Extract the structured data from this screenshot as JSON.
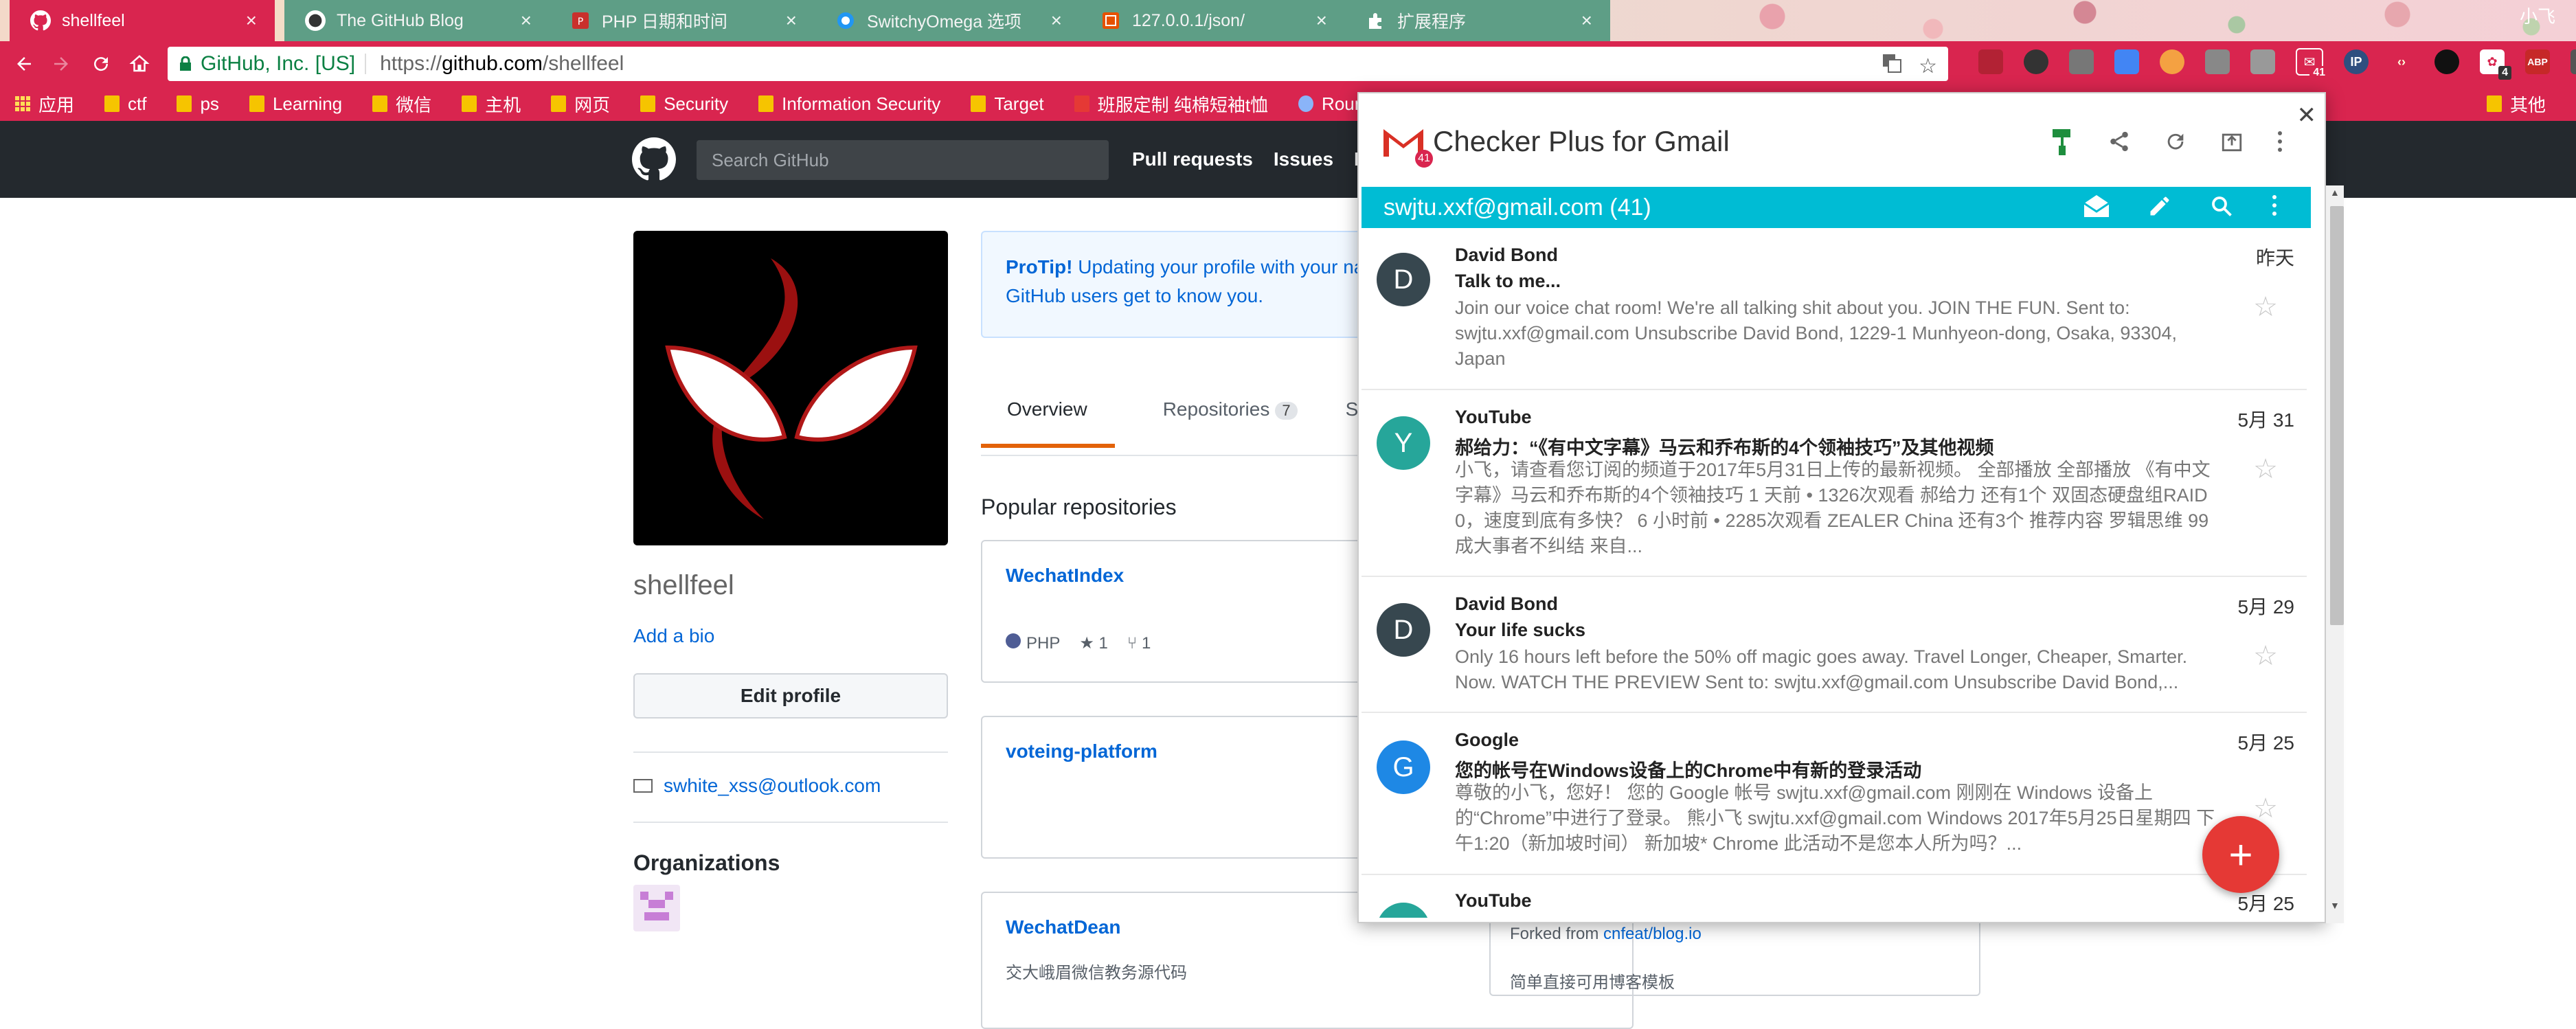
{
  "browser": {
    "tabs": [
      {
        "title": "shellfeel",
        "active": true
      },
      {
        "title": "The GitHub Blog",
        "active": false
      },
      {
        "title": "PHP 日期和时间",
        "active": false
      },
      {
        "title": "SwitchyOmega 选项",
        "active": false
      },
      {
        "title": "127.0.0.1/json/",
        "active": false
      },
      {
        "title": "扩展程序",
        "active": false
      }
    ],
    "window_user": "小飞",
    "ev_cert": "GitHub, Inc. [US]",
    "url_scheme": "https://",
    "url_host": "github.com",
    "url_path": "/shellfeel",
    "ext_badges": {
      "gmail": "41",
      "ext2": "4"
    },
    "ext_labels": {
      "ip": "IP",
      "abp": "ABP"
    },
    "bookmarks": [
      "应用",
      "ctf",
      "ps",
      "Learning",
      "微信",
      "主机",
      "网页",
      "Security",
      "Information Security",
      "Target",
      "班服定制 纯棉短袖t恤",
      "Roundcube Webm"
    ],
    "bookmarks_overflow": "其他"
  },
  "github": {
    "search_placeholder": "Search GitHub",
    "nav": [
      "Pull requests",
      "Issues",
      "M"
    ],
    "username": "shellfeel",
    "add_bio": "Add a bio",
    "edit_profile": "Edit profile",
    "email": "swhite_xss@outlook.com",
    "organizations": "Organizations",
    "protip_bold": "ProTip!",
    "protip_line1": " Updating your profile with your na",
    "protip_line2": "GitHub users get to know you.",
    "tabs": {
      "overview": "Overview",
      "repositories": "Repositories",
      "repo_count": "7",
      "stars": "Star"
    },
    "popular": "Popular repositories",
    "repos": [
      {
        "name": "WechatIndex",
        "desc": "",
        "lang": "PHP",
        "stars": "1",
        "forks": "1"
      },
      {
        "name": "voteing-platform",
        "desc": ""
      },
      {
        "name": "WechatDean",
        "desc": "交大峨眉微信教务源代码"
      }
    ],
    "forked_prefix": "Forked from ",
    "forked_link": "cnfeat/blog.io",
    "bottom_desc": "简单直接可用博客模板"
  },
  "checker": {
    "title": "Checker Plus for Gmail",
    "logo_count": "41",
    "account": "swjtu.xxf@gmail.com (41)",
    "emails": [
      {
        "sender": "David Bond",
        "initial": "D",
        "color": "#37474f",
        "subject": "Talk to me...",
        "date": "昨天",
        "snippet": "Join our voice chat room! We're all talking shit about you. JOIN THE FUN. Sent to: swjtu.xxf@gmail.com Unsubscribe David Bond, 1229-1 Munhyeon-dong, Osaka, 93304, Japan"
      },
      {
        "sender": "YouTube",
        "initial": "Y",
        "color": "#26a69a",
        "subject": "郝给力：“《有中文字幕》马云和乔布斯的4个领袖技巧”及其他视频",
        "date": "5月 31",
        "snippet": "小飞，请查看您订阅的频道于2017年5月31日上传的最新视频。 全部播放 全部播放 《有中文字幕》马云和乔布斯的4个领袖技巧 1 天前 • 1326次观看 郝给力 还有1个 双固态硬盘组RAID 0，速度到底有多快？ 6 小时前 • 2285次观看 ZEALER China 还有3个 推荐内容 罗辑思维 99 成大事者不纠结 来自..."
      },
      {
        "sender": "David Bond",
        "initial": "D",
        "color": "#37474f",
        "subject": "Your life sucks",
        "date": "5月 29",
        "snippet": "Only 16 hours left before the 50% off magic goes away. Travel Longer, Cheaper, Smarter. Now. WATCH THE PREVIEW Sent to: swjtu.xxf@gmail.com Unsubscribe David Bond,..."
      },
      {
        "sender": "Google",
        "initial": "G",
        "color": "#1e88e5",
        "subject": "您的帐号在Windows设备上的Chrome中有新的登录活动",
        "date": "5月 25",
        "snippet": "尊敬的小飞，您好！ 您的 Google 帐号 swjtu.xxf@gmail.com 刚刚在 Windows 设备上的“Chrome”中进行了登录。 熊小飞 swjtu.xxf@gmail.com Windows 2017年5月25日星期四 下午1:20（新加坡时间） 新加坡* Chrome 此活动不是您本人所为吗？..."
      },
      {
        "sender": "YouTube",
        "initial": "Y",
        "color": "#26a69a",
        "subject": "",
        "date": "5月 25",
        "snippet": ""
      }
    ]
  }
}
